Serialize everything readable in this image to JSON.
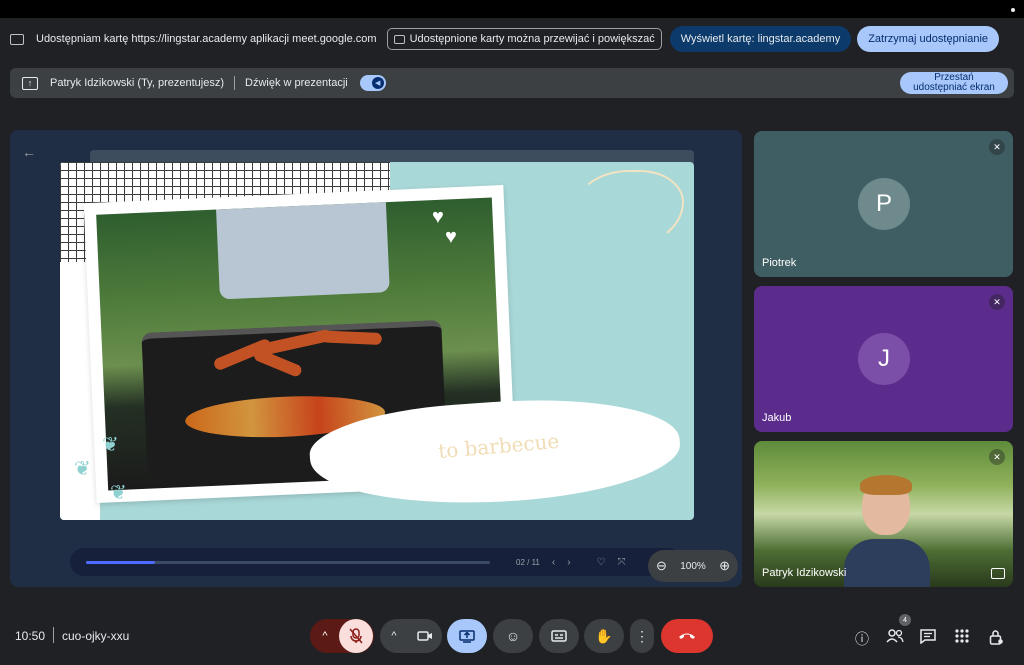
{
  "share_bar": {
    "sharing_text": "Udostępniam kartę https://lingstar.academy aplikacji meet.google.com",
    "info_text": "Udostępnione karty można przewijać i powiększać",
    "view_tab_label": "Wyświetl kartę: lingstar.academy",
    "stop_sharing_label": "Zatrzymaj udostępnianie"
  },
  "presenter_bar": {
    "presenter_text": "Patryk Idzikowski (Ty, prezentujesz)",
    "audio_label": "Dźwięk w prezentacji",
    "stop_screen_label_1": "Przestań",
    "stop_screen_label_2": "udostępniać ekran"
  },
  "slide": {
    "caption": "to barbecue",
    "page": "02 / 11",
    "progress": 0.17
  },
  "zoom": {
    "value": "100%"
  },
  "participants": [
    {
      "name": "Piotrek",
      "initial": "P",
      "color": "#3f5e63"
    },
    {
      "name": "Jakub",
      "initial": "J",
      "color": "#5c2c8c"
    },
    {
      "name": "Patryk Idzikowski"
    }
  ],
  "meeting": {
    "time": "10:50",
    "code": "cuo-ojky-xxu",
    "people_count": "4"
  },
  "colors": {
    "accent": "#a8c7fa",
    "hangup": "#dc362e",
    "stage": "#1f2d45"
  }
}
